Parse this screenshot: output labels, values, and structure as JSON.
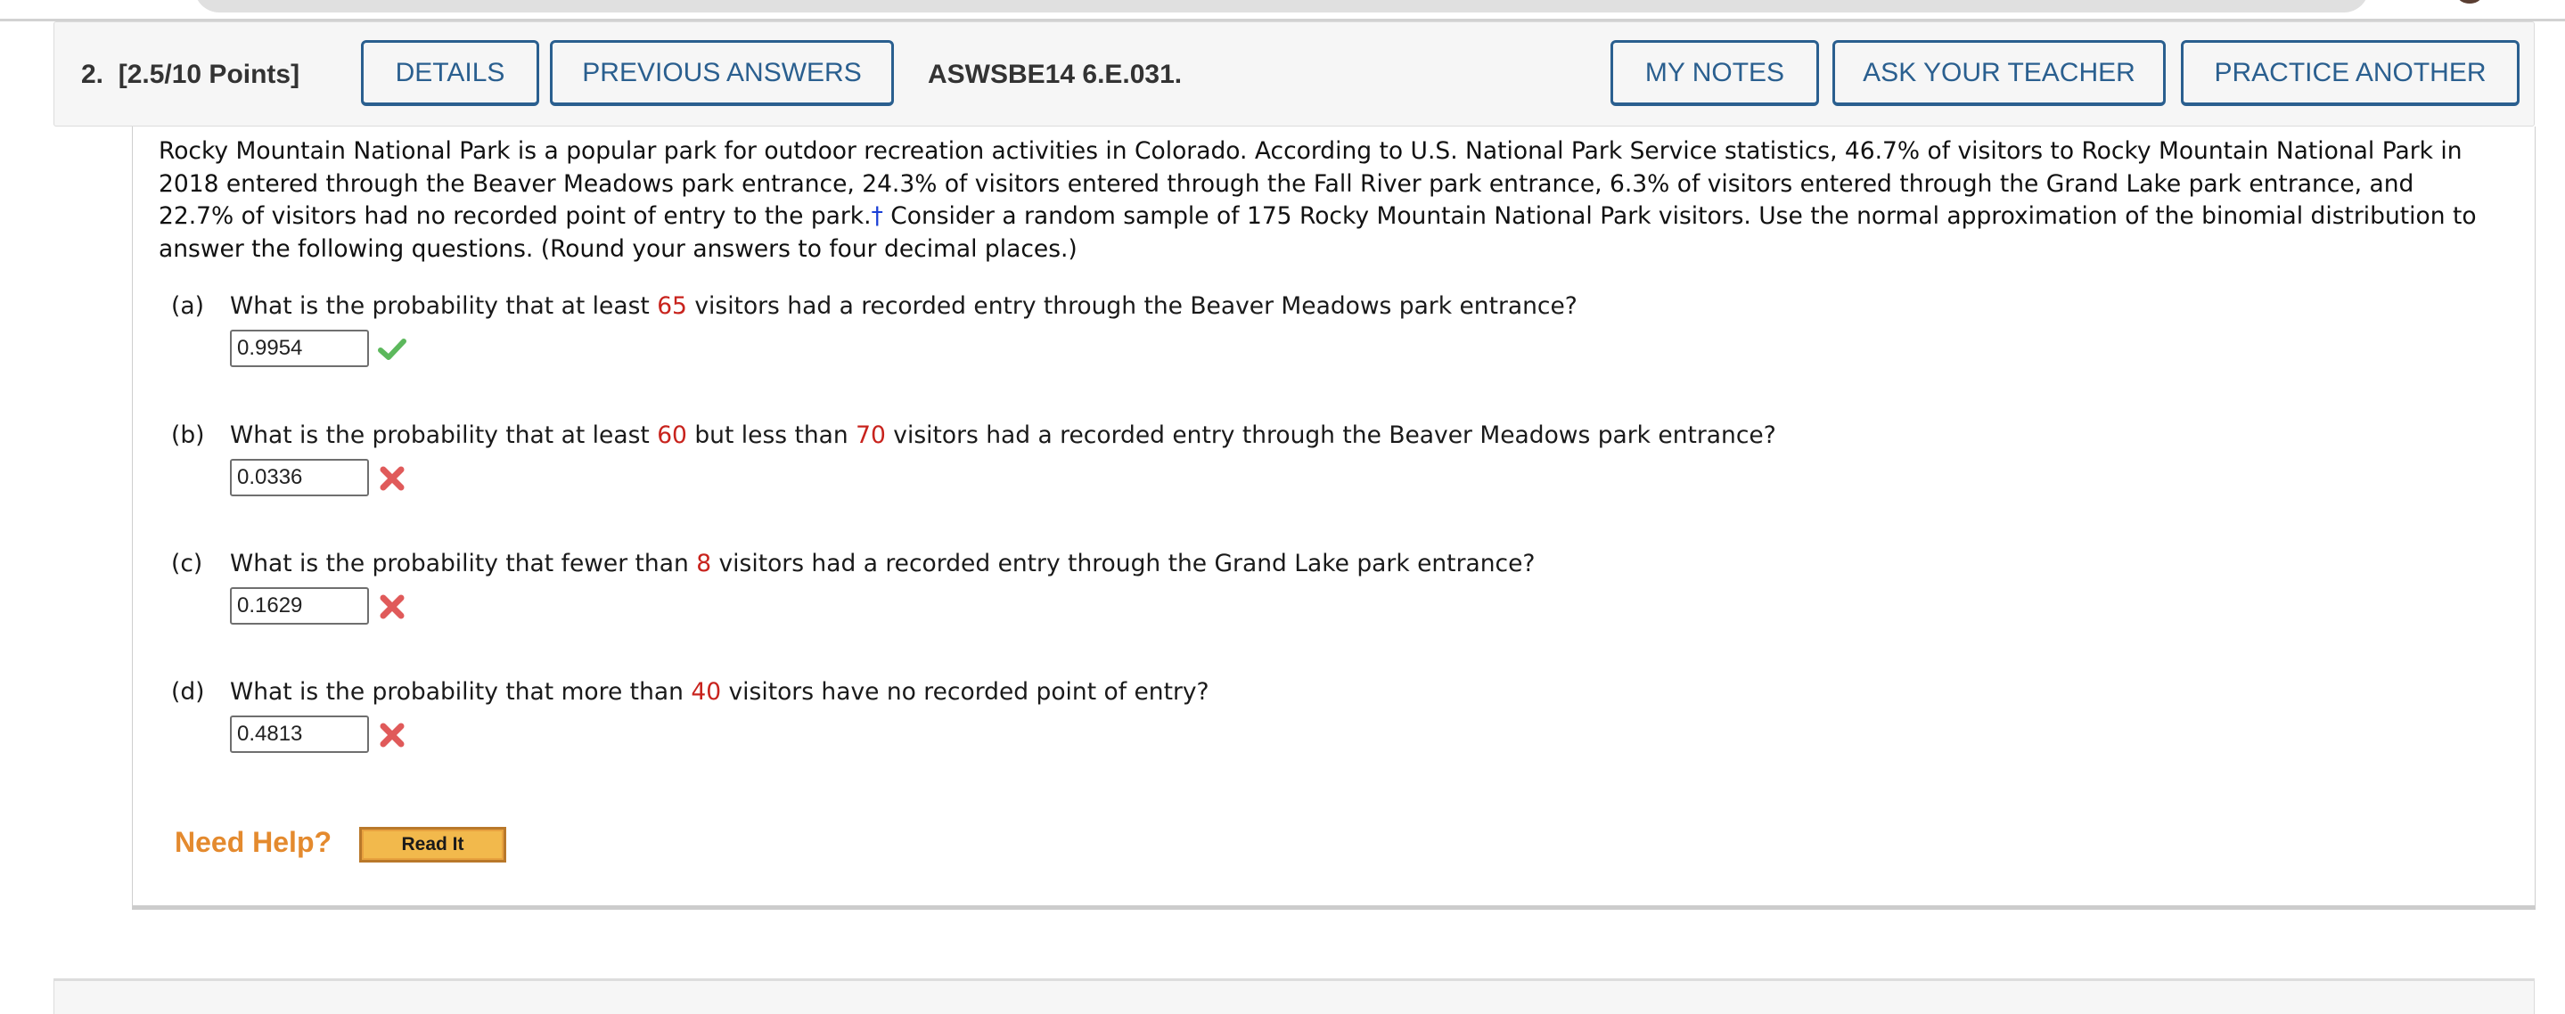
{
  "header": {
    "question_number": "2.",
    "points": "[2.5/10 Points]",
    "buttons": {
      "details": "DETAILS",
      "previous_answers": "PREVIOUS ANSWERS",
      "my_notes": "MY NOTES",
      "ask_your_teacher": "ASK YOUR TEACHER",
      "practice_another": "PRACTICE ANOTHER"
    },
    "problem_code": "ASWSBE14 6.E.031."
  },
  "intro": {
    "text_before_dagger": "Rocky Mountain National Park is a popular park for outdoor recreation activities in Colorado. According to U.S. National Park Service statistics, 46.7% of visitors to Rocky Mountain National Park in 2018 entered through the Beaver Meadows park entrance, 24.3% of visitors entered through the Fall River park entrance, 6.3% of visitors entered through the Grand Lake park entrance, and 22.7% of visitors had no recorded point of entry to the park.",
    "dagger": "†",
    "text_after_dagger": " Consider a random sample of 175 Rocky Mountain National Park visitors. Use the normal approximation of the binomial distribution to answer the following questions. (Round your answers to four decimal places.)"
  },
  "parts": [
    {
      "label": "(a)",
      "text_1": "What is the probability that at least ",
      "value_1": "65",
      "text_2": " visitors had a recorded entry through the Beaver Meadows park entrance?",
      "answer": "0.9954",
      "status": "correct"
    },
    {
      "label": "(b)",
      "text_1": "What is the probability that at least ",
      "value_1": "60",
      "text_2": " but less than ",
      "value_2": "70",
      "text_3": " visitors had a recorded entry through the Beaver Meadows park entrance?",
      "answer": "0.0336",
      "status": "incorrect"
    },
    {
      "label": "(c)",
      "text_1": "What is the probability that fewer than ",
      "value_1": "8",
      "text_2": " visitors had a recorded entry through the Grand Lake park entrance?",
      "answer": "0.1629",
      "status": "incorrect"
    },
    {
      "label": "(d)",
      "text_1": "What is the probability that more than ",
      "value_1": "40",
      "text_2": " visitors have no recorded point of entry?",
      "answer": "0.4813",
      "status": "incorrect"
    }
  ],
  "help": {
    "label": "Need Help?",
    "read_it": "Read It"
  },
  "colors": {
    "button_blue": "#2a5f8f",
    "highlight_red": "#c8231d",
    "correct_green": "#5cb85c",
    "incorrect_red": "#e05a5a",
    "help_orange": "#e48a2e"
  }
}
